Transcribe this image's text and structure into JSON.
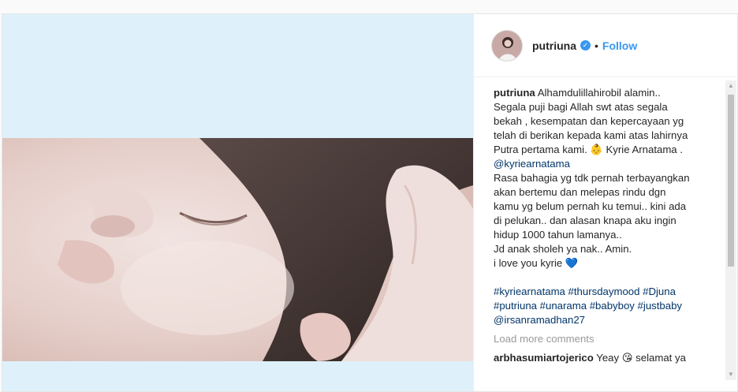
{
  "header": {
    "username": "putriuna",
    "verified_icon": "verified-badge-icon",
    "separator": "•",
    "follow_label": "Follow"
  },
  "caption": {
    "username": "putriuna",
    "lines": [
      "Alhamdulillahirobil alamin..",
      "Segala puji bagi Allah swt atas segala",
      "bekah , kesempatan dan kepercayaan yg",
      "telah di berikan kepada kami atas lahirnya",
      "Putra pertama kami. 👶 Kyrie Arnatama .",
      "@kyriearnatama",
      "Rasa bahagia yg tdk pernah terbayangkan",
      "akan bertemu dan melepas rindu dgn",
      "kamu yg belum pernah ku temui.. kini ada",
      "di pelukan.. dan alasan knapa aku ingin",
      "hidup 1000 tahun lamanya..",
      "Jd anak sholeh ya nak.. Amin.",
      "i love you kyrie 💙"
    ],
    "hashtag_lines": [
      "#kyriearnatama #thursdaymood #Djuna",
      "#putriuna #unarama #babyboy #justbaby",
      "@irsanramadhan27"
    ]
  },
  "load_more_label": "Load more comments",
  "comments": [
    {
      "username": "arbhasumiartojerico",
      "text": "Yeay 😘 selamat ya"
    }
  ],
  "colors": {
    "accent": "#3897f0",
    "link": "#003569",
    "media_bg": "#def1fb"
  }
}
